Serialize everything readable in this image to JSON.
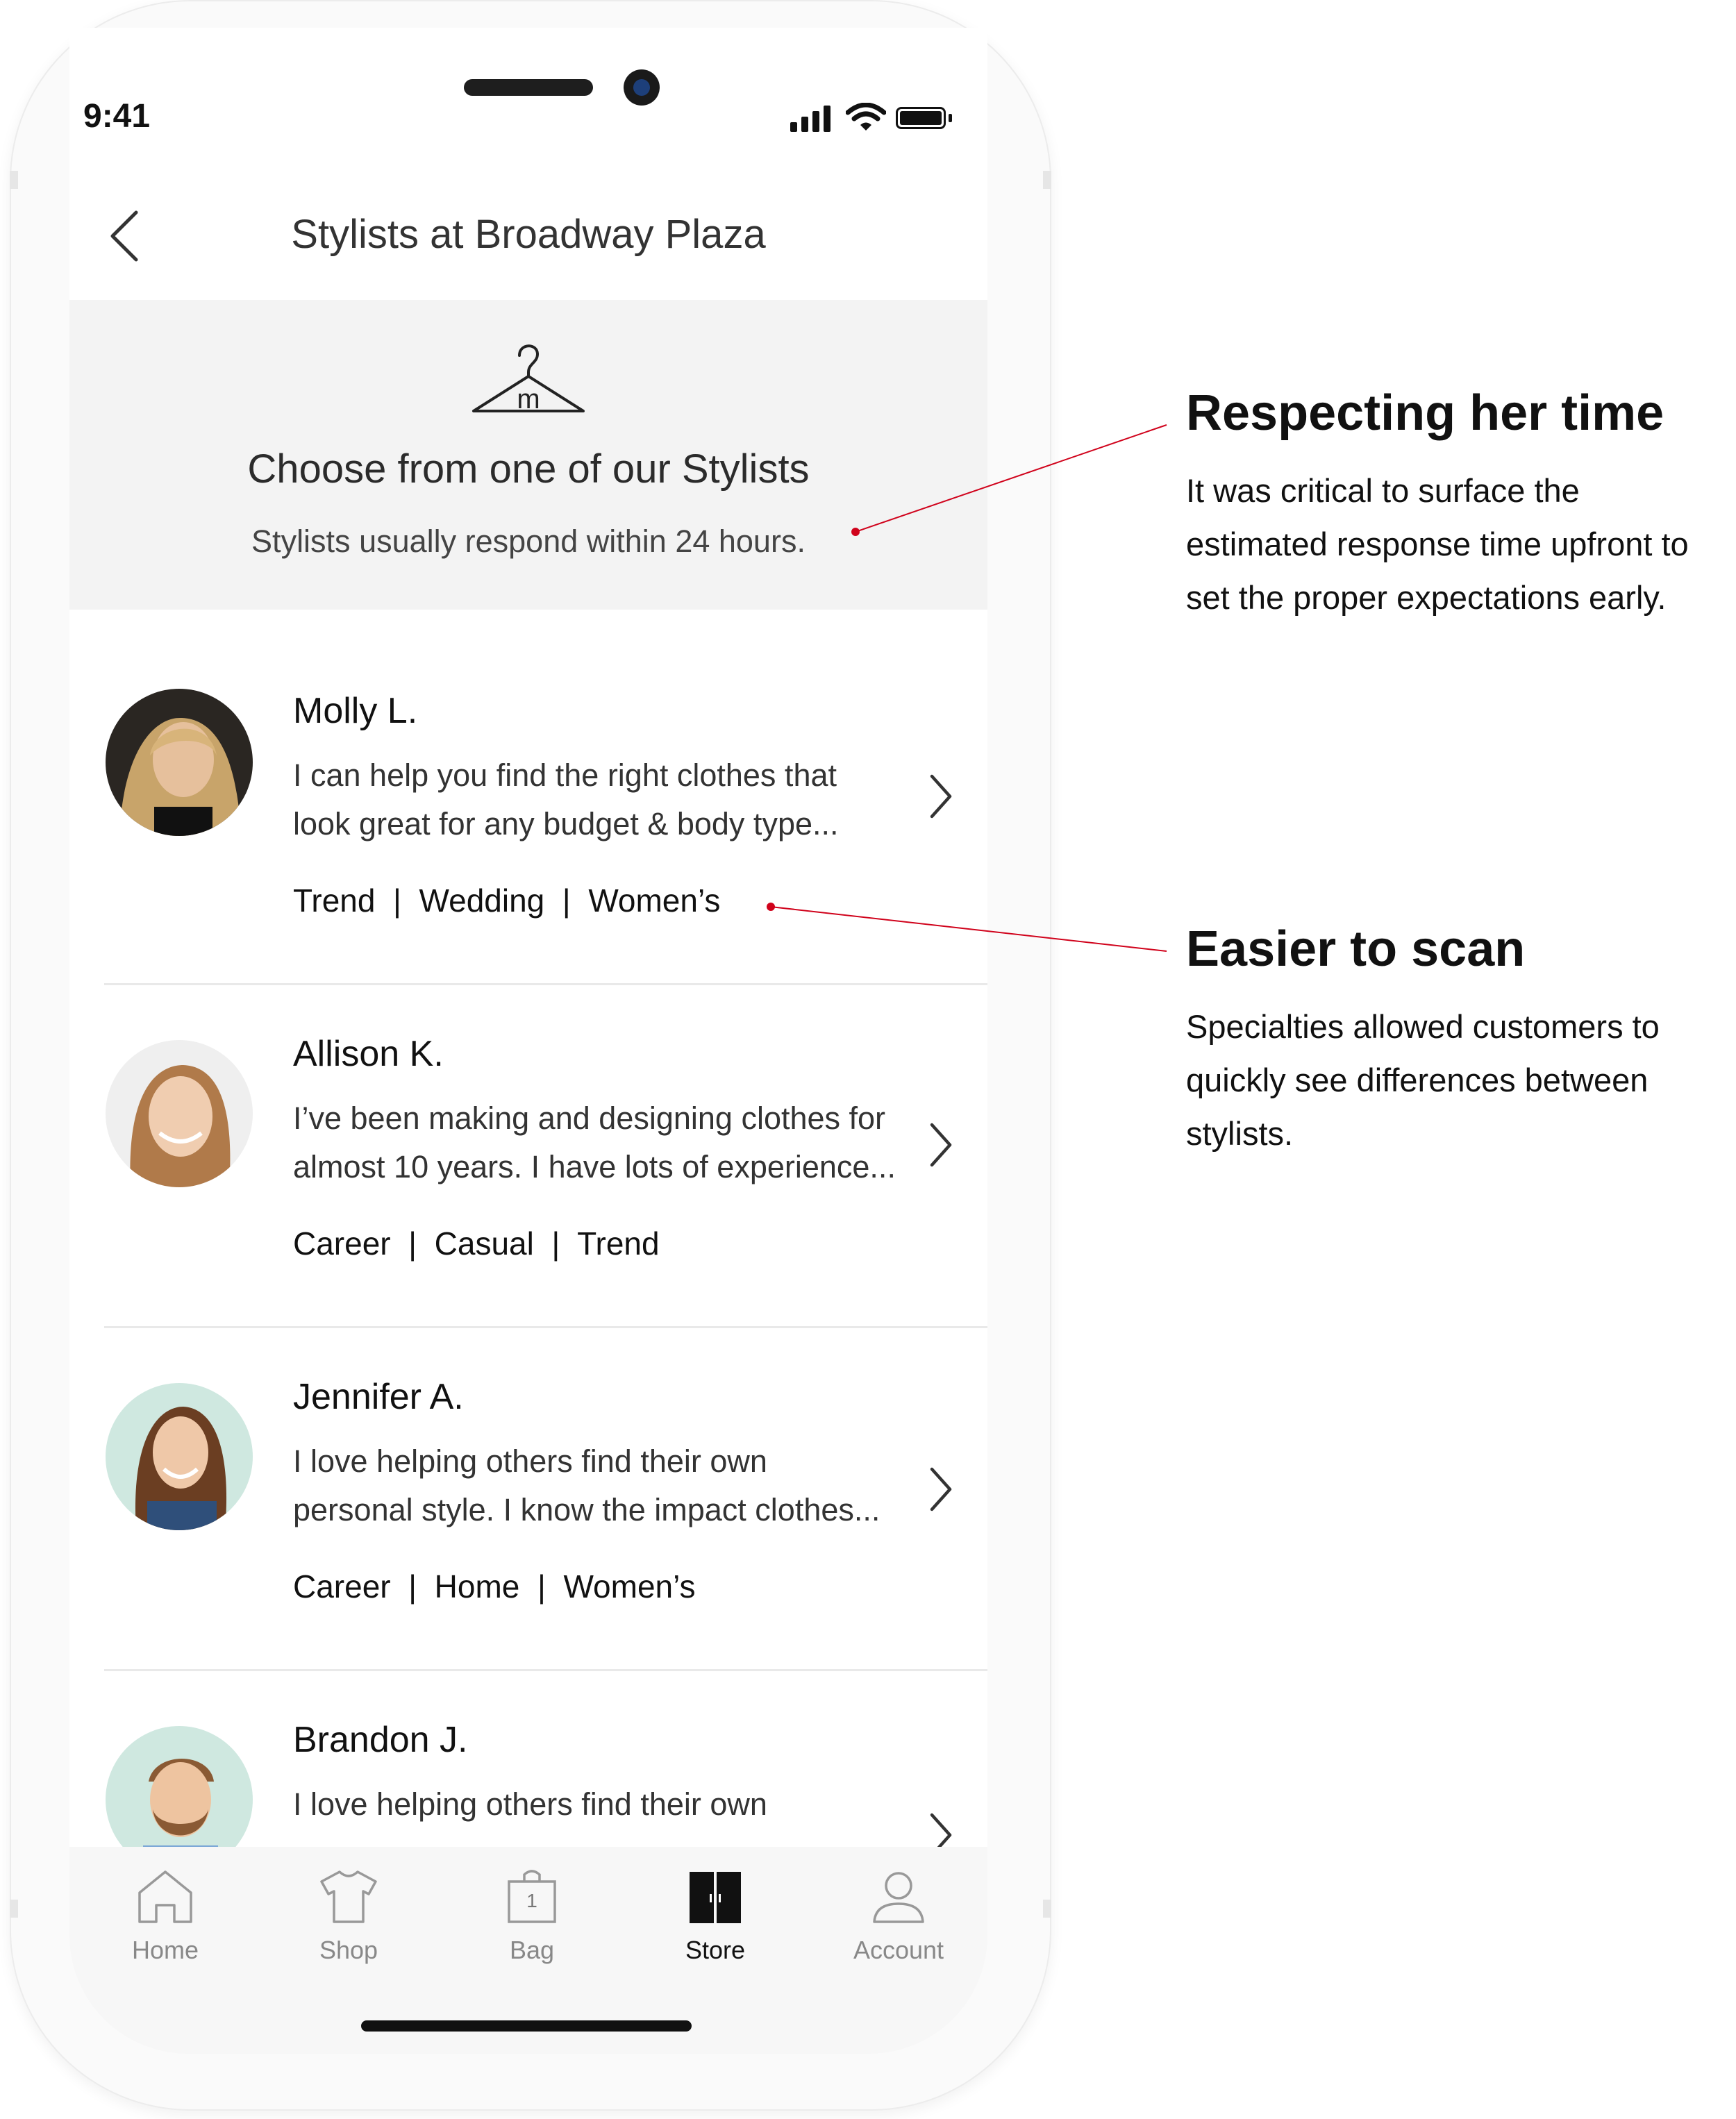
{
  "status_bar": {
    "time": "9:41"
  },
  "header": {
    "title": "Stylists at Broadway Plaza"
  },
  "banner": {
    "title": "Choose from one of our Stylists",
    "subtitle": "Stylists usually respond within 24 hours."
  },
  "stylists": [
    {
      "name": "Molly L.",
      "bio_line1": "I can help you find the right clothes that",
      "bio_line2": "look great for any budget & body type...",
      "tags": "Trend  |  Wedding  |  Women’s"
    },
    {
      "name": "Allison K.",
      "bio_line1": "I’ve been making and designing clothes for",
      "bio_line2": "almost 10 years.  I have lots of experience...",
      "tags": "Career  |  Casual  |  Trend"
    },
    {
      "name": "Jennifer A.",
      "bio_line1": "I love helping others find their own",
      "bio_line2": "personal style.  I know the impact clothes...",
      "tags": "Career  |  Home  |  Women’s"
    },
    {
      "name": "Brandon J.",
      "bio_line1": "I love helping others find their own",
      "bio_line2": "",
      "tags": ""
    }
  ],
  "tabbar": {
    "items": [
      {
        "label": "Home",
        "icon": "home-icon"
      },
      {
        "label": "Shop",
        "icon": "shirt-icon"
      },
      {
        "label": "Bag",
        "icon": "bag-icon",
        "badge": "1"
      },
      {
        "label": "Store",
        "icon": "store-icon",
        "active": true
      },
      {
        "label": "Account",
        "icon": "account-icon"
      }
    ]
  },
  "annotations": [
    {
      "title": "Respecting her time",
      "lines": [
        "It was critical to surface the",
        "estimated response time upfront to",
        "set the proper expectations early."
      ]
    },
    {
      "title": "Easier to scan",
      "lines": [
        "Specialties allowed customers to",
        "quickly see differences between",
        "stylists."
      ]
    }
  ],
  "colors": {
    "accent_red": "#d0021b",
    "banner_bg": "#f3f3f3",
    "text_dark": "#111111",
    "tab_inactive": "#888888"
  }
}
